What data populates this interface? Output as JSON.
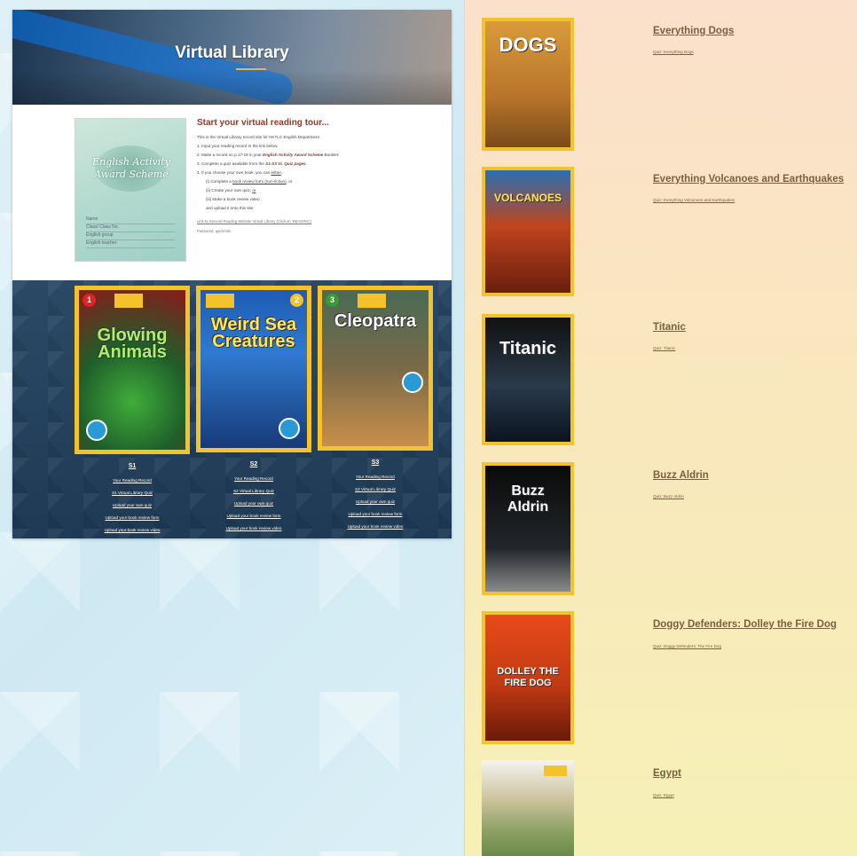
{
  "left_panel": {
    "header_title": "Virtual Library",
    "booklet": {
      "title": "English Activity Award Scheme",
      "fields": [
        "Name",
        "Class/ Class No.",
        "English group",
        "English teacher"
      ]
    },
    "intro": {
      "heading": "Start your virtual reading tour...",
      "line1": "This is the Virtual Library record site for HKTLC English Department.",
      "line2": "1. Input your reading record in the link below.",
      "line3_a": "2. Make a record on p.17-19 in your ",
      "line3_em": "English Activity Award Scheme",
      "line3_b": " Booklet.",
      "line4_a": "3. Complete a quiz available from the ",
      "line4_em": "S1-S3 VL Quiz pages",
      "line4_b": ".",
      "line5_a": "4. If you choose your own book, you can ",
      "line5_link": "either",
      "line5_b": "...",
      "opt1_a": "(i) Complete a ",
      "opt1_link": "book review form (non-fiction)",
      "opt1_b": ", or",
      "opt2_a": "(ii) Create your own quiz, ",
      "opt2_link": "or",
      "opt3": "(iii) Make a book review video",
      "opt4": "and upload it onto this site",
      "link_note": "Link to General Reading Website Virtual Library (Click on 'READING')",
      "password": "Password: quickhole"
    },
    "books": [
      {
        "number": "1",
        "cover_title": "Glowing Animals",
        "grade": "S1",
        "links": [
          "Your Reading Record",
          "S1 Virtual Library Quiz",
          "Upload your own quiz",
          "Upload your book review form",
          "Upload your book review video"
        ]
      },
      {
        "number": "2",
        "cover_title": "Weird Sea Creatures",
        "grade": "S2",
        "links": [
          "Your Reading Record",
          "S2 Virtual Library Quiz",
          "Upload your own quiz",
          "Upload your book review form",
          "Upload your book review video"
        ]
      },
      {
        "number": "3",
        "cover_title": "Cleopatra",
        "grade": "S3",
        "links": [
          "Your Reading Record",
          "S3 Virtual Library Quiz",
          "Upload your own quiz",
          "Upload your book review form",
          "Upload your book review video"
        ]
      }
    ]
  },
  "right_panel": {
    "items": [
      {
        "title": "Everything Dogs",
        "quiz": "Quiz: Everything Dogs",
        "cover_text": "DOGS"
      },
      {
        "title": "Everything Volcanoes and Earthquakes",
        "quiz": "Quiz: Everything Volcanoes and Earthquakes",
        "cover_text": "VOLCANOES"
      },
      {
        "title": "Titanic",
        "quiz": "Quiz: Titanic",
        "cover_text": "Titanic"
      },
      {
        "title": "Buzz Aldrin",
        "quiz": "Quiz: Buzz Aldrin",
        "cover_text": "Buzz Aldrin"
      },
      {
        "title": "Doggy Defenders: Dolley the Fire Dog",
        "quiz": "Quiz: Doggy Defenders: The Fire Dog",
        "cover_text": "DOLLEY THE FIRE DOG"
      },
      {
        "title": "Egypt",
        "quiz": "Quiz: Egypt",
        "cover_text": ""
      }
    ]
  },
  "colors": {
    "accent_yellow": "#f4c22a",
    "heading_brown": "#8a3a2a",
    "right_title": "#7a6040",
    "panel_navy": "#1f3a55"
  }
}
